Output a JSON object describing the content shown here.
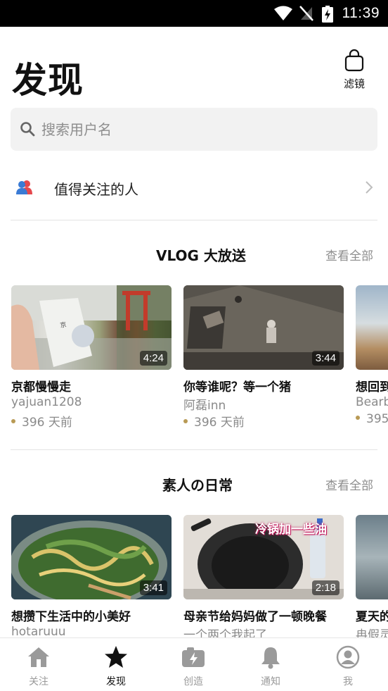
{
  "status_bar": {
    "time": "11:39"
  },
  "header": {
    "title": "发现",
    "filter_label": "滤镜"
  },
  "search": {
    "placeholder": "搜索用户名"
  },
  "follow": {
    "label": "值得关注的人"
  },
  "sections": [
    {
      "title": "VLOG 大放送",
      "see_all": "查看全部",
      "cards": [
        {
          "title": "京都慢慢走",
          "author": "yajuan1208",
          "age": "396 天前",
          "duration": "4:24"
        },
        {
          "title": "你等谁呢？等一个猪",
          "author": "阿磊inn",
          "age": "396 天前",
          "duration": "3:44"
        },
        {
          "title": "想回到",
          "author": "Bearb",
          "age": "395",
          "duration": ""
        }
      ]
    },
    {
      "title": "素人の日常",
      "see_all": "查看全部",
      "cards": [
        {
          "title": "想攒下生活中的小美好",
          "author": "hotaruuu",
          "age": "",
          "duration": "3:41"
        },
        {
          "title": "母亲节给妈妈做了一顿晚餐",
          "author": "一个两个我起了",
          "age": "",
          "duration": "2:18",
          "overlay_text": "冷锅加一些油"
        },
        {
          "title": "夏天的",
          "author": "冉假灵",
          "age": "",
          "duration": ""
        }
      ]
    }
  ],
  "bottom_nav": [
    {
      "label": "关注",
      "icon": "home-icon"
    },
    {
      "label": "发现",
      "icon": "star-icon",
      "active": true
    },
    {
      "label": "创造",
      "icon": "camera-bolt-icon"
    },
    {
      "label": "通知",
      "icon": "bell-icon"
    },
    {
      "label": "我",
      "icon": "profile-icon"
    }
  ],
  "colors": {
    "accent_dot": "#b89a55",
    "follow_icon_red": "#e5484d",
    "follow_icon_blue": "#3a7bd5"
  }
}
